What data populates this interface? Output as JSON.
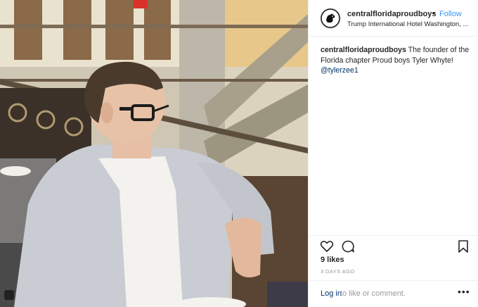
{
  "post": {
    "header": {
      "username": "centralfloridaproudboys",
      "separator": "•",
      "follow_label": "Follow",
      "location": "Trump International Hotel Washington, ...",
      "avatar_icon": "rooster-logo-icon"
    },
    "caption": {
      "username": "centralfloridaproudboys",
      "text": " The founder of the Florida chapter Proud boys Tyler Whyte! ",
      "mention": "@tylerzee1"
    },
    "actions": {
      "like_icon": "heart-icon",
      "comment_icon": "comment-icon",
      "save_icon": "bookmark-icon"
    },
    "likes": "9 likes",
    "timestamp": "3 DAYS AGO",
    "login": {
      "link_label": "Log in",
      "rest_text": " to like or comment.",
      "more_label": "•••"
    },
    "colors": {
      "link_blue": "#3897f0",
      "mention_blue": "#003569",
      "muted_gray": "#999999",
      "text": "#262626",
      "border": "#efefef"
    }
  }
}
